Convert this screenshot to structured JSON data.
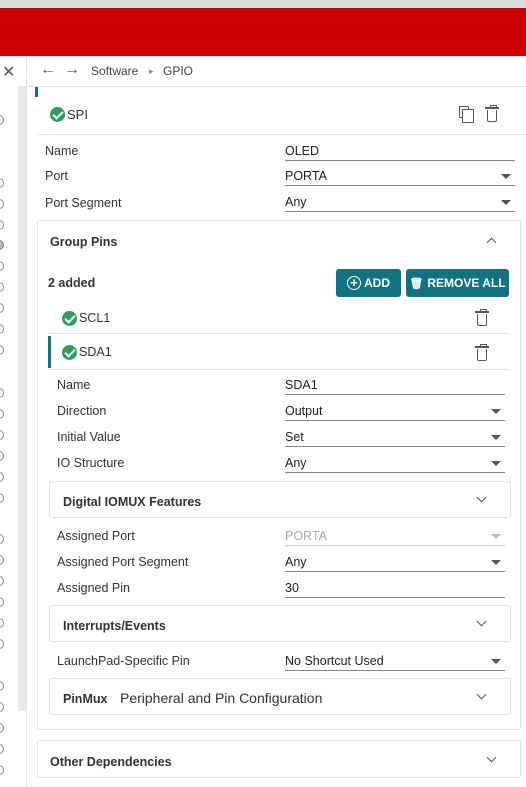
{
  "breadcrumb": {
    "root": "Software",
    "current": "GPIO"
  },
  "group": {
    "name_value": "SPI",
    "fields": {
      "name": {
        "label": "Name",
        "value": "OLED"
      },
      "port": {
        "label": "Port",
        "value": "PORTA"
      },
      "port_segment": {
        "label": "Port Segment",
        "value": "Any"
      }
    }
  },
  "group_pins": {
    "title": "Group Pins",
    "count_text": "2 added",
    "add_label": "ADD",
    "remove_all_label": "REMOVE ALL",
    "pins": [
      {
        "name": "SCL1"
      },
      {
        "name": "SDA1"
      }
    ],
    "selected": {
      "name": {
        "label": "Name",
        "value": "SDA1"
      },
      "direction": {
        "label": "Direction",
        "value": "Output"
      },
      "initial_value": {
        "label": "Initial Value",
        "value": "Set"
      },
      "io_structure": {
        "label": "IO Structure",
        "value": "Any"
      }
    }
  },
  "iomux": {
    "title": "Digital IOMUX Features",
    "assigned_port": {
      "label": "Assigned Port",
      "value": "PORTA"
    },
    "assigned_port_segment": {
      "label": "Assigned Port Segment",
      "value": "Any"
    },
    "assigned_pin": {
      "label": "Assigned Pin",
      "value": "30"
    }
  },
  "interrupts": {
    "title": "Interrupts/Events"
  },
  "launchpad": {
    "label": "LaunchPad-Specific Pin",
    "value": "No Shortcut Used"
  },
  "pinmux": {
    "title": "PinMux",
    "subtitle": "Peripheral and Pin Configuration"
  },
  "other_deps": {
    "title": "Other Dependencies"
  },
  "colors": {
    "brand_red": "#cc0000",
    "accent_teal": "#137282",
    "check_green": "#2e9e5b"
  }
}
